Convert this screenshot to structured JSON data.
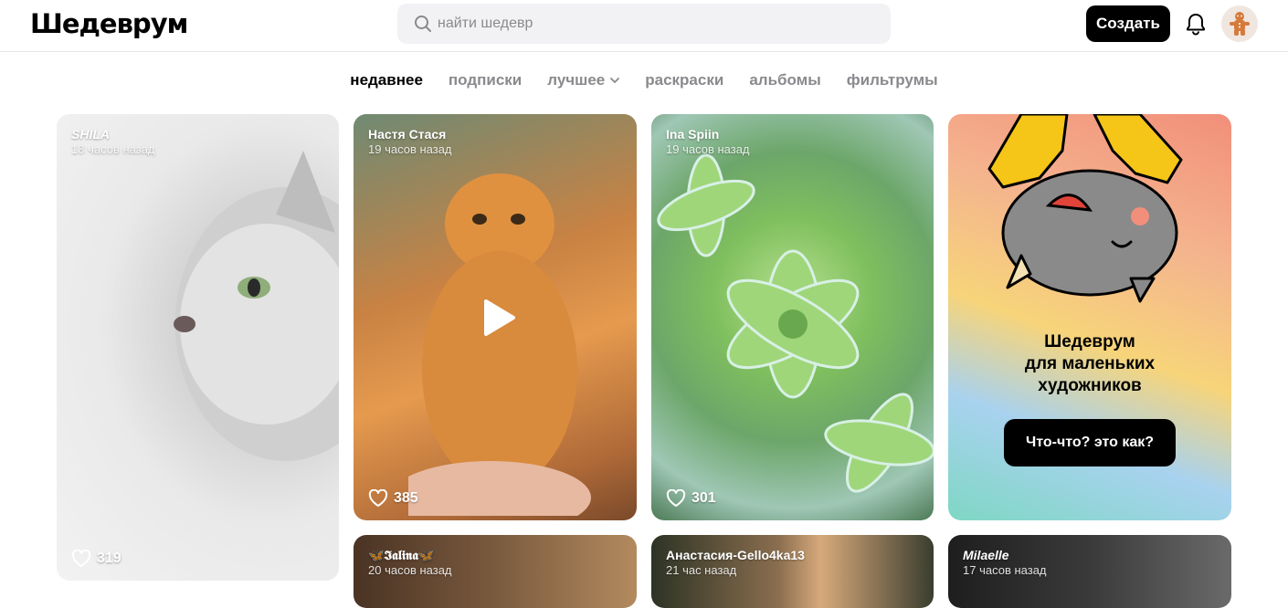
{
  "header": {
    "logo": "Шедеврум",
    "search_placeholder": "найти шедевр",
    "create_label": "Создать"
  },
  "tabs": [
    {
      "label": "недавнее"
    },
    {
      "label": "подписки"
    },
    {
      "label": "лучшее"
    },
    {
      "label": "раскраски"
    },
    {
      "label": "альбомы"
    },
    {
      "label": "фильтрумы"
    }
  ],
  "cards": [
    {
      "author": "SHILA",
      "time": "18 часов назад",
      "likes": "319"
    },
    {
      "author": "Настя Стася",
      "time": "19 часов назад",
      "likes": "385"
    },
    {
      "author": "Ina Spiin",
      "time": "19 часов назад",
      "likes": "301"
    },
    {
      "author": "🦋𝕴𝖆𝖑𝖎𝖓𝖆🦋",
      "time": "20 часов назад"
    },
    {
      "author": "Анастасия-Gello4ka13",
      "time": "21 час назад"
    },
    {
      "author": "Milaelle",
      "time": "17 часов назад"
    }
  ],
  "promo": {
    "title": "Шедеврум\nдля маленьких\nхудожников",
    "button": "Что-что? это как?"
  },
  "colors": {
    "accent": "#000000",
    "tab_inactive": "#8a8a8e",
    "search_bg": "#f2f2f4"
  }
}
